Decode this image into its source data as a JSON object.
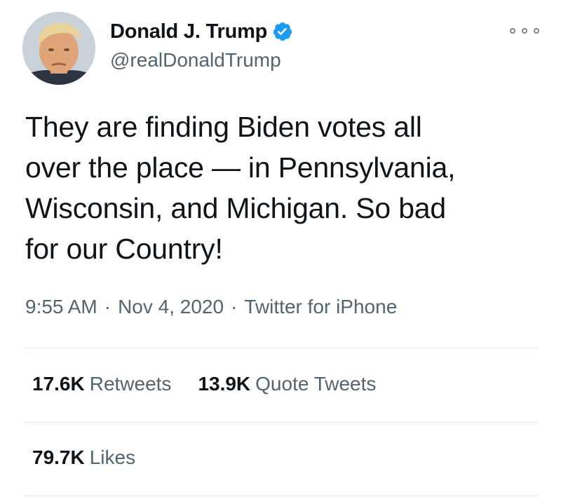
{
  "author": {
    "display_name": "Donald J. Trump",
    "handle": "@realDonaldTrump",
    "verified": true,
    "verified_color": "#1d9bf0"
  },
  "tweet": {
    "text": "They are finding Biden votes all\nover the place — in Pennsylvania,\nWisconsin, and Michigan. So bad\nfor our Country!"
  },
  "meta": {
    "time": "9:55 AM",
    "date": "Nov 4, 2020",
    "source": "Twitter for iPhone",
    "separator": "·"
  },
  "stats": {
    "retweets": {
      "count": "17.6K",
      "label": "Retweets"
    },
    "quote_tweets": {
      "count": "13.9K",
      "label": "Quote Tweets"
    },
    "likes": {
      "count": "79.7K",
      "label": "Likes"
    }
  },
  "icons": {
    "more": "more-options-icon",
    "verified": "verified-badge-icon"
  }
}
